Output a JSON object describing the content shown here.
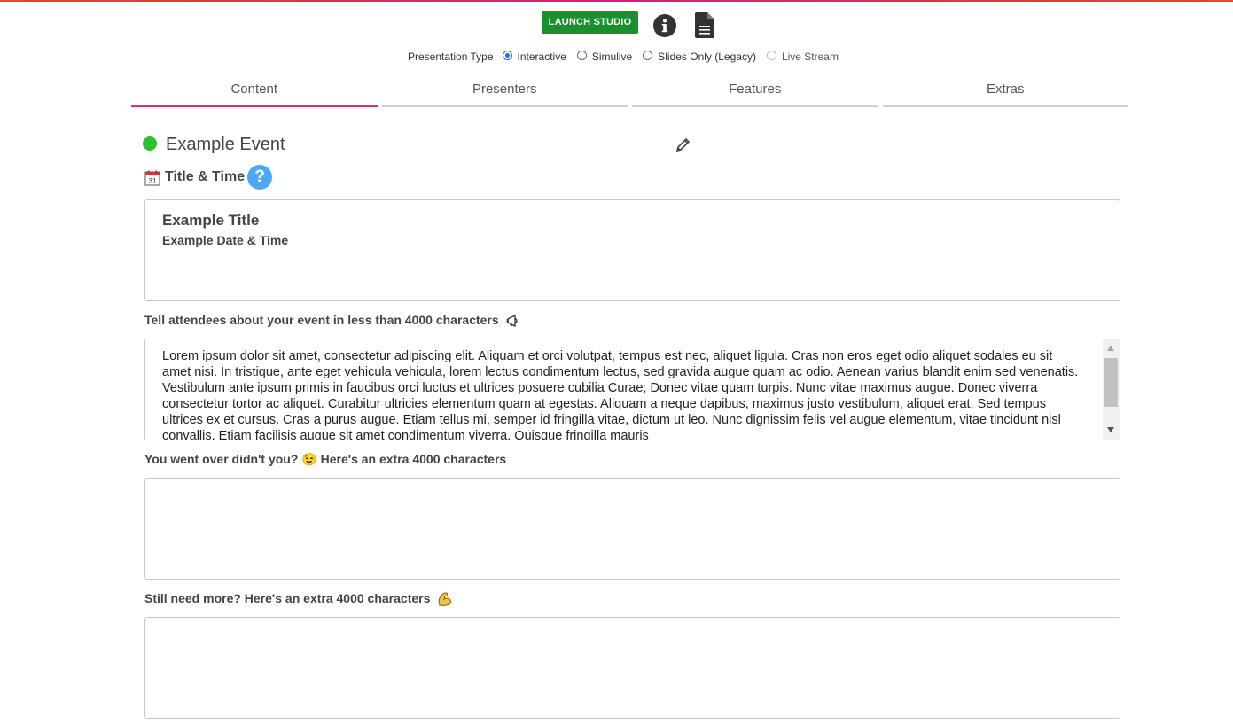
{
  "header": {
    "launch_label": "LAUNCH STUDIO",
    "info_icon": "info-circle-icon",
    "document_icon": "document-icon"
  },
  "presentation_type": {
    "label": "Presentation Type",
    "options": [
      {
        "label": "Interactive",
        "selected": true,
        "disabled": false
      },
      {
        "label": "Simulive",
        "selected": false,
        "disabled": false
      },
      {
        "label": "Slides Only (Legacy)",
        "selected": false,
        "disabled": false
      },
      {
        "label": "Live Stream",
        "selected": false,
        "disabled": true
      }
    ]
  },
  "tabs": [
    {
      "label": "Content",
      "active": true
    },
    {
      "label": "Presenters",
      "active": false
    },
    {
      "label": "Features",
      "active": false
    },
    {
      "label": "Extras",
      "active": false
    }
  ],
  "event": {
    "status_color": "#2fbf2f",
    "name": "Example Event",
    "edit_icon": "pencil-icon"
  },
  "title_section": {
    "icon": "calendar-icon",
    "heading": "Title & Time",
    "help_icon": "question-icon",
    "help_glyph": "?",
    "title": "Example Title",
    "datetime": "Example Date & Time"
  },
  "description": {
    "label": "Tell attendees about your event in less than 4000 characters",
    "label_icon": "megaphone-icon",
    "text": " Lorem ipsum dolor sit amet, consectetur adipiscing elit. Aliquam et orci volutpat, tempus est nec, aliquet ligula. Cras non eros eget odio aliquet sodales eu sit amet nisi. In tristique, ante eget vehicula vehicula, lorem lectus condimentum lectus, sed gravida augue quam ac odio. Aenean varius blandit enim sed venenatis. Vestibulum ante ipsum primis in faucibus orci luctus et ultrices posuere cubilia Curae; Donec vitae quam turpis. Nunc vitae maximus augue. Donec viverra consectetur tortor ac aliquet. Curabitur ultricies elementum quam at egestas. Aliquam a neque dapibus, maximus justo vestibulum, aliquet erat. Sed tempus ultrices ex et cursus. Cras a purus augue. Etiam tellus mi, semper id fringilla vitae, dictum ut leo. Nunc dignissim felis vel augue elementum, vitae tincidunt nisl convallis. Etiam facilisis augue sit amet condimentum viverra. Quisque fringilla mauris"
  },
  "extra1": {
    "label": "You went over didn't you? 😉 Here's an extra 4000 characters",
    "value": ""
  },
  "extra2": {
    "label": "Still need more? Here's an extra 4000 characters",
    "label_icon": "flexed-biceps-icon",
    "value": ""
  }
}
